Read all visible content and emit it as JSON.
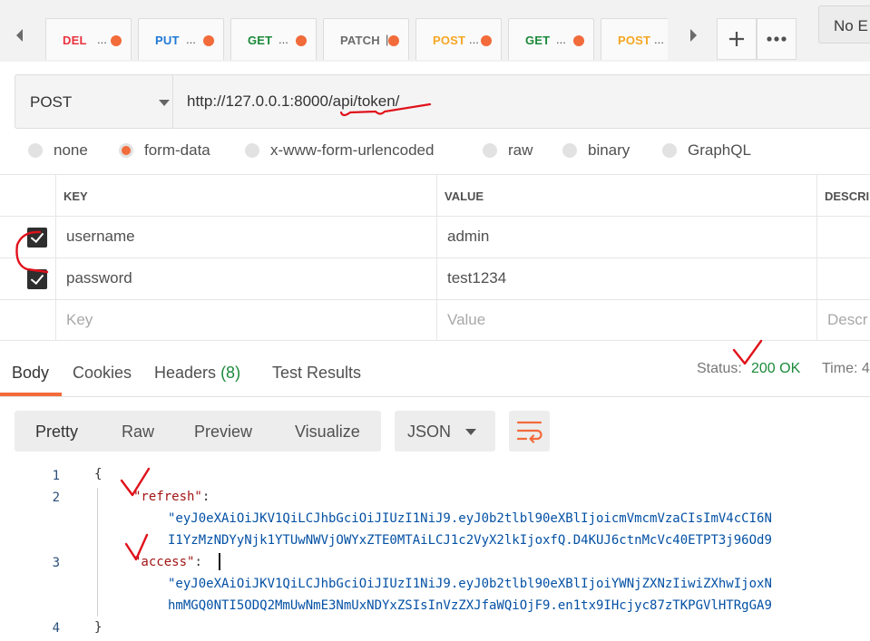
{
  "tabs": [
    {
      "method": "DEL",
      "ellipsis": "..."
    },
    {
      "method": "PUT",
      "ellipsis": "..."
    },
    {
      "method": "GET",
      "ellipsis": "..."
    },
    {
      "method": "PATCH",
      "ellipsis": "|"
    },
    {
      "method": "POST",
      "ellipsis": "..."
    },
    {
      "method": "GET",
      "ellipsis": "..."
    },
    {
      "method": "POST",
      "ellipsis": "..."
    }
  ],
  "environment": {
    "label": "No E"
  },
  "request": {
    "method": "POST",
    "url": "http://127.0.0.1:8000/api/token/"
  },
  "body_types": [
    "none",
    "form-data",
    "x-www-form-urlencoded",
    "raw",
    "binary",
    "GraphQL"
  ],
  "selected_body_type": "form-data",
  "params_table": {
    "headers": [
      "KEY",
      "VALUE",
      "DESCRI"
    ],
    "rows": [
      {
        "key": "username",
        "value": "admin",
        "checked": true
      },
      {
        "key": "password",
        "value": "test1234",
        "checked": true
      }
    ],
    "placeholder": {
      "key": "Key",
      "value": "Value",
      "description": "Descr"
    }
  },
  "response": {
    "tabs": {
      "body": "Body",
      "cookies": "Cookies",
      "headers": "Headers",
      "headers_count": "(8)",
      "tests": "Test Results"
    },
    "status_label": "Status:",
    "status_value": "200 OK",
    "time_label": "Time:",
    "time_value": "4"
  },
  "format": {
    "modes": [
      "Pretty",
      "Raw",
      "Preview",
      "Visualize"
    ],
    "active": "Pretty",
    "language": "JSON"
  },
  "code": {
    "line_numbers": [
      "1",
      "2",
      "3",
      "4"
    ],
    "open_brace": "{",
    "close_brace": "}",
    "refresh_key": "\"refresh\"",
    "refresh_line1": "\"eyJ0eXAiOiJKV1QiLCJhbGciOiJIUzI1NiJ9.eyJ0b2tlbl90eXBlIjoicmVmcmVzaCIsImV4cCI6N",
    "refresh_line2": "I1YzMzNDYyNjk1YTUwNWVjOWYxZTE0MTAiLCJ1c2VyX2lkIjoxfQ.D4KUJ6ctnMcVc40ETPT3j96Od9",
    "access_key": "\"access\"",
    "access_line1": "\"eyJ0eXAiOiJKV1QiLCJhbGciOiJIUzI1NiJ9.eyJ0b2tlbl90eXBlIjoiYWNjZXNzIiwiZXhwIjoxN",
    "access_line2": "hmMGQ0NTI5ODQ2MmUwNmE3NmUxNDYxZSIsInVzZXJfaWQiOjF9.en1tx9IHcjyc87zTKPGVlHTRgGA9"
  },
  "colors": {
    "accent": "#f26b3a",
    "status_ok": "#1b8a3a",
    "annotation": "#e0111b"
  }
}
